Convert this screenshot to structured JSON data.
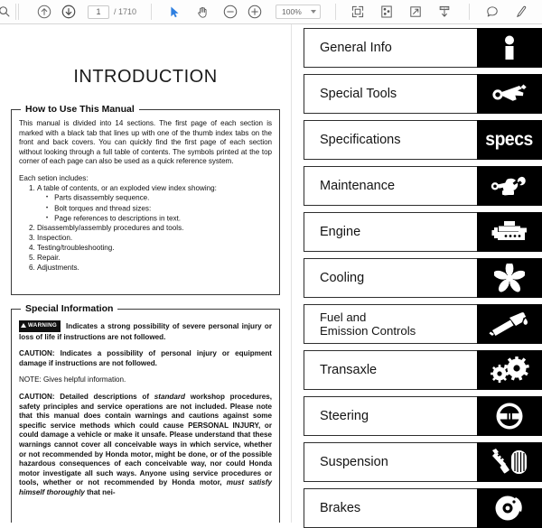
{
  "toolbar": {
    "search_icon": "search-icon",
    "prev_page_icon": "arrow-up-circle-icon",
    "next_page_icon": "arrow-down-circle-icon",
    "page_number": "1",
    "page_total": "/ 1710",
    "select_tool_icon": "cursor-arrow-icon",
    "pan_tool_icon": "hand-icon",
    "zoom_out_icon": "minus-circle-icon",
    "zoom_in_icon": "plus-circle-icon",
    "zoom_level": "100%",
    "zoom_dropdown_icon": "chevron-down-icon",
    "fit_page_icon": "fit-page-icon",
    "thumbnail_icon": "thumbnail-icon",
    "fullscreen_icon": "fullscreen-icon",
    "download_icon": "download-icon",
    "comment_icon": "comment-bubble-icon",
    "draw_icon": "pen-icon"
  },
  "document": {
    "title": "INTRODUCTION",
    "how_to": {
      "heading": "How to Use This Manual",
      "paragraph1": "This manual is divided into 14 sections. The first page of each section is marked with a black tab that lines up with one of the thumb index tabs on the front and back covers. You can quickly find the first page of each section without looking through a full table of contents. The symbols printed at the top corner of each page can also be used as a quick reference system.",
      "intro_line": "Each setion includes:",
      "items": [
        "A table of contents, or an exploded view index showing:",
        "Disassembly/assembly procedures and tools.",
        "Inspection.",
        "Testing/troubleshooting.",
        "Repair.",
        "Adjustments."
      ],
      "sub_items": [
        "Parts disassembly sequence.",
        "Bolt torques and thread sizes:",
        "Page references to descriptions in text."
      ]
    },
    "special_info": {
      "heading": "Special Information",
      "warning_badge": "WARNING",
      "warning_text": "Indicates a strong possibility of severe personal injury or loss of life if instructions are not followed.",
      "caution_text": "CAUTION: Indicates a possibility of personal injury or equipment damage if instructions are not followed.",
      "note_text": "NOTE:  Gives helpful information.",
      "long_caution_a": "CAUTION: Detailed descriptions of ",
      "long_caution_italic": "standard",
      "long_caution_b": " workshop procedures, safety principles and service operations are not included. Please note that this manual does contain warnings and cautions against some specific service methods which could cause PERSONAL INJURY, or could damage a vehicle or make it unsafe. Please understand that these warnings cannot cover all conceivable ways in which service, whether or not recommended by Honda motor, might be done, or of the possible hazardous consequences of each conceivable way, nor could Honda motor investigate all such ways. Anyone using service procedures or tools, whether or not recommended by Honda motor, ",
      "long_caution_italic2": "must satisfy himself thoroughly",
      "long_caution_c": " that nei-"
    }
  },
  "tabs": [
    {
      "label": "General Info",
      "icon": "information-person-icon"
    },
    {
      "label": "Special Tools",
      "icon": "wrench-icon"
    },
    {
      "label": "Specifications",
      "icon_text": "specs",
      "icon": "specs-text-icon"
    },
    {
      "label": "Maintenance",
      "icon": "hand-wrench-icon"
    },
    {
      "label": "Engine",
      "icon": "engine-block-icon"
    },
    {
      "label": "Cooling",
      "icon": "fan-icon"
    },
    {
      "label": "Fuel and",
      "label2": "Emission Controls",
      "icon": "fuel-nozzle-icon"
    },
    {
      "label": "Transaxle",
      "icon": "gears-icon"
    },
    {
      "label": "Steering",
      "icon": "steering-wheel-icon"
    },
    {
      "label": "Suspension",
      "icon": "shock-absorber-tire-icon"
    },
    {
      "label": "Brakes",
      "icon": "brake-disc-icon"
    }
  ],
  "colors": {
    "tab_icon_background": "#000000",
    "tab_border": "#2e2e2e",
    "page_background": "#ffffff",
    "toolbar_background": "#fdfdfd"
  }
}
